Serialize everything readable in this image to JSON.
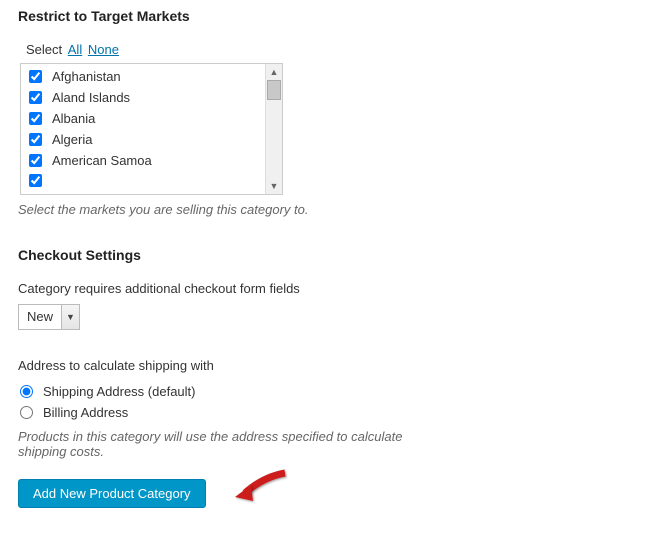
{
  "markets": {
    "heading": "Restrict to Target Markets",
    "select_label": "Select",
    "all_link": "All",
    "none_link": "None",
    "items": [
      {
        "label": "Afghanistan",
        "checked": true
      },
      {
        "label": "Aland Islands",
        "checked": true
      },
      {
        "label": "Albania",
        "checked": true
      },
      {
        "label": "Algeria",
        "checked": true
      },
      {
        "label": "American Samoa",
        "checked": true
      }
    ],
    "help": "Select the markets you are selling this category to."
  },
  "checkout": {
    "heading": "Checkout Settings",
    "form_fields_label": "Category requires additional checkout form fields",
    "form_fields_value": "New",
    "address_label": "Address to calculate shipping with",
    "radios": [
      {
        "label": "Shipping Address (default)",
        "checked": true
      },
      {
        "label": "Billing Address",
        "checked": false
      }
    ],
    "address_help": "Products in this category will use the address specified to calculate shipping costs."
  },
  "submit": {
    "label": "Add New Product Category"
  }
}
